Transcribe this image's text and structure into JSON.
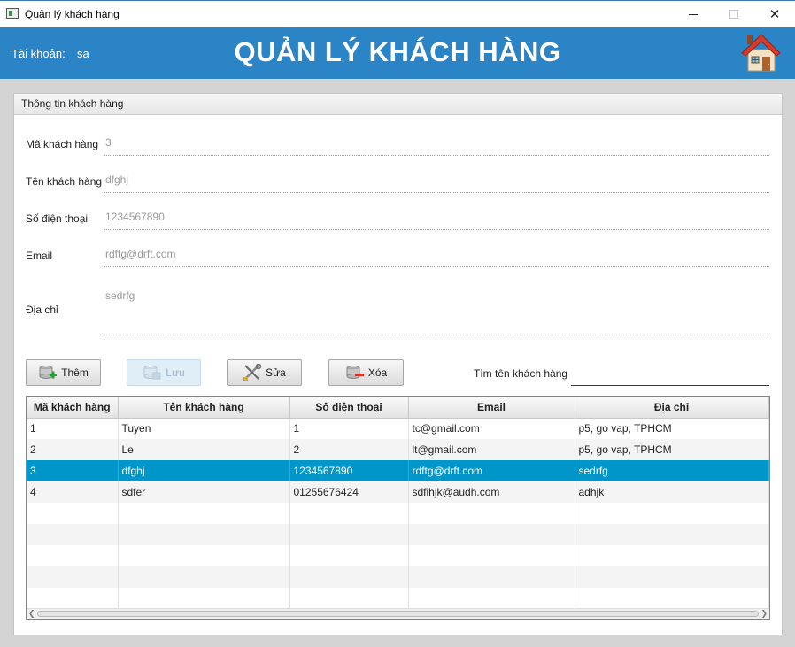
{
  "window": {
    "title": "Quản lý khách hàng"
  },
  "header": {
    "account_label": "Tài khoản:",
    "account_value": "sa",
    "title": "QUẢN LÝ KHÁCH HÀNG",
    "home_icon": "home-icon"
  },
  "panel": {
    "title": "Thông tin khách hàng"
  },
  "form": {
    "id_label": "Mã khách hàng",
    "id_value": "3",
    "name_label": "Tên khách hàng",
    "name_value": "dfghj",
    "phone_label": "Số điện thoại",
    "phone_value": "1234567890",
    "email_label": "Email",
    "email_value": "rdftg@drft.com",
    "address_label": "Địa chỉ",
    "address_value": "sedrfg"
  },
  "toolbar": {
    "add_label": "Thêm",
    "save_label": "Lưu",
    "edit_label": "Sửa",
    "delete_label": "Xóa",
    "search_label": "Tìm tên khách hàng",
    "search_value": ""
  },
  "table": {
    "columns": [
      "Mã khách hàng",
      "Tên khách hàng",
      "Số điện thoại",
      "Email",
      "Địa chỉ"
    ],
    "rows": [
      [
        "1",
        "Tuyen",
        "1",
        "tc@gmail.com",
        "p5, go vap, TPHCM"
      ],
      [
        "2",
        "Le",
        "2",
        "lt@gmail.com",
        "p5, go vap, TPHCM"
      ],
      [
        "3",
        "dfghj",
        "1234567890",
        "rdftg@drft.com",
        "sedrfg"
      ],
      [
        "4",
        "sdfer",
        "01255676424",
        "sdfihjk@audh.com",
        "adhjk"
      ]
    ],
    "selected_row": 2,
    "selection_color": "#0096c9"
  },
  "colors": {
    "header_bg": "#2a84c6",
    "accent": "#3a9ad9"
  }
}
